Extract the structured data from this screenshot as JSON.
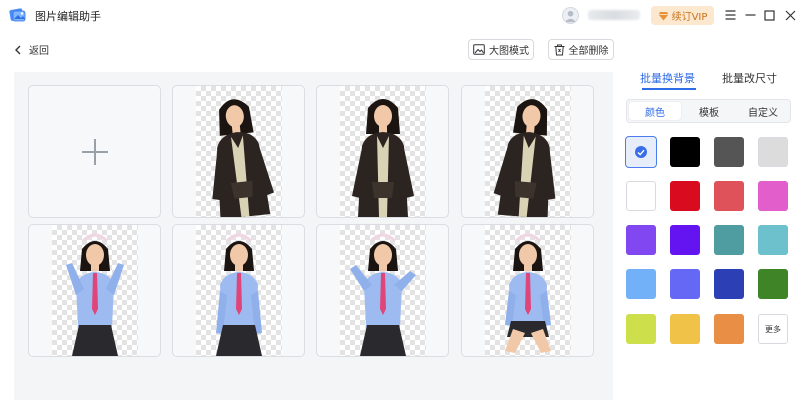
{
  "app": {
    "title": "图片编辑助手"
  },
  "header": {
    "vip_label": "续订VIP"
  },
  "toolbar": {
    "back_label": "返回",
    "large_view_label": "大图模式",
    "delete_all_label": "全部删除"
  },
  "panel": {
    "tabs": [
      "批量换背景",
      "批量改尺寸"
    ],
    "active_tab": "批量换背景",
    "subtabs": [
      "颜色",
      "模板",
      "自定义"
    ],
    "active_subtab": "颜色",
    "more_label": "更多",
    "colors": [
      {
        "name": "transparent",
        "hex": "#e8edfb",
        "selected": true
      },
      {
        "name": "black",
        "hex": "#000000"
      },
      {
        "name": "dark-gray",
        "hex": "#555555"
      },
      {
        "name": "light-gray",
        "hex": "#dcdcdc"
      },
      {
        "name": "white",
        "hex": "#ffffff"
      },
      {
        "name": "red",
        "hex": "#d90c1f"
      },
      {
        "name": "coral-red",
        "hex": "#e0525a"
      },
      {
        "name": "pink",
        "hex": "#e25fcb"
      },
      {
        "name": "purple",
        "hex": "#8147f0"
      },
      {
        "name": "violet",
        "hex": "#6314f0"
      },
      {
        "name": "teal",
        "hex": "#4f9da0"
      },
      {
        "name": "aqua",
        "hex": "#6cc1cc"
      },
      {
        "name": "sky-blue",
        "hex": "#72b0f7"
      },
      {
        "name": "periwinkle",
        "hex": "#6468f4"
      },
      {
        "name": "royal-blue",
        "hex": "#2c3fb4"
      },
      {
        "name": "green",
        "hex": "#3f8427"
      },
      {
        "name": "lime",
        "hex": "#cde04b"
      },
      {
        "name": "amber",
        "hex": "#f0c248"
      },
      {
        "name": "orange",
        "hex": "#e88f45"
      }
    ]
  },
  "images": [
    {
      "kind": "add"
    },
    {
      "kind": "photo",
      "outfit": "dark-jacket",
      "pose": "lean"
    },
    {
      "kind": "photo",
      "outfit": "dark-jacket",
      "pose": "front"
    },
    {
      "kind": "photo",
      "outfit": "dark-jacket",
      "pose": "turn"
    },
    {
      "kind": "photo",
      "outfit": "blue-shirt",
      "pose": "hands-up"
    },
    {
      "kind": "photo",
      "outfit": "blue-shirt",
      "pose": "standing"
    },
    {
      "kind": "photo",
      "outfit": "blue-shirt",
      "pose": "arms-raised"
    },
    {
      "kind": "photo",
      "outfit": "blue-shirt",
      "pose": "sitting"
    }
  ],
  "colors": {
    "accent": "#2e6be6",
    "vip_bg": "#fce7cf",
    "vip_text": "#c8741c"
  }
}
